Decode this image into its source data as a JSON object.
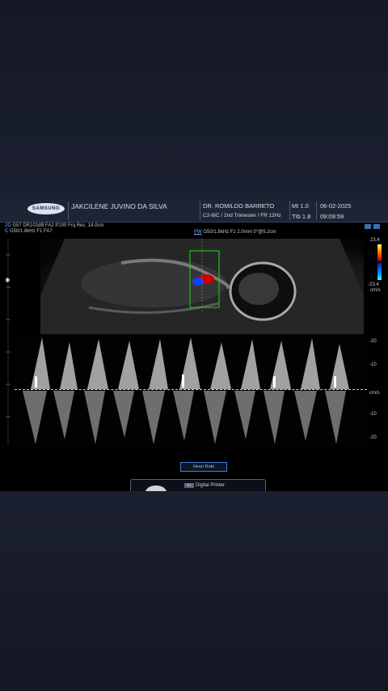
{
  "header": {
    "logo": "SAMSUNG",
    "patient_name": "JAKCILENE JUVINO DA SILVA",
    "doctor": "DR. ROMILDO BARRETO",
    "probe_preset": "C2-6IC / 2nd Trimester / FR 12Hz",
    "mi": "MI  1.0",
    "tib": "TIb 1.8",
    "date": "06-02-2025",
    "time": "09:09:59"
  },
  "params": {
    "line1_prefix": "2D",
    "line1": "G57 DR102dB FA2 P100 Frq Res. 14.0cm",
    "line2_prefix": "C",
    "line2": "G50/1.8kHz F1 FA7",
    "pw_label": "PW",
    "pw_params": "G50/1.8kHz F1 2.0mm 0°@5.2cm"
  },
  "color_scale": {
    "top": "23.4",
    "bottom": "-23.4",
    "unit": "cm/s"
  },
  "doppler_scale": {
    "t1": "-20",
    "t2": "-10",
    "unit": "cm/s",
    "b1": "-10",
    "b2": "-20"
  },
  "heart_rate_button": "Heart Rate",
  "printer": {
    "badge": "P1",
    "label": "Digital Printer"
  }
}
